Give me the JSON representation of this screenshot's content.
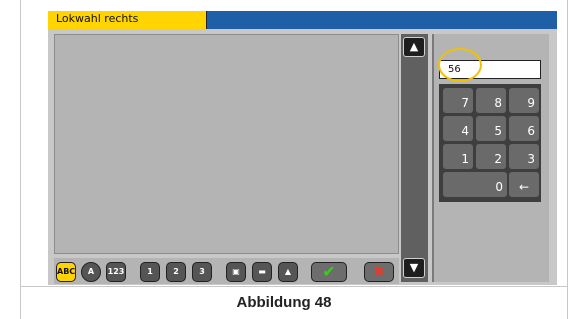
{
  "window": {
    "tab_title": "Lokwahl rechts"
  },
  "scroll": {
    "up_icon": "arrow-up-icon",
    "down_icon": "arrow-down-icon"
  },
  "toolbar": {
    "abc": "ABC",
    "a": "A",
    "n123": "123",
    "loco1": "1",
    "loco2": "2",
    "loco3": "3",
    "ok": "✔",
    "cancel": "✖"
  },
  "numpad": {
    "value": "56",
    "keys": [
      "7",
      "8",
      "9",
      "4",
      "5",
      "6",
      "1",
      "2",
      "3",
      "0"
    ],
    "backspace_icon": "backspace-arrow-icon"
  },
  "caption": "Abbildung 48"
}
